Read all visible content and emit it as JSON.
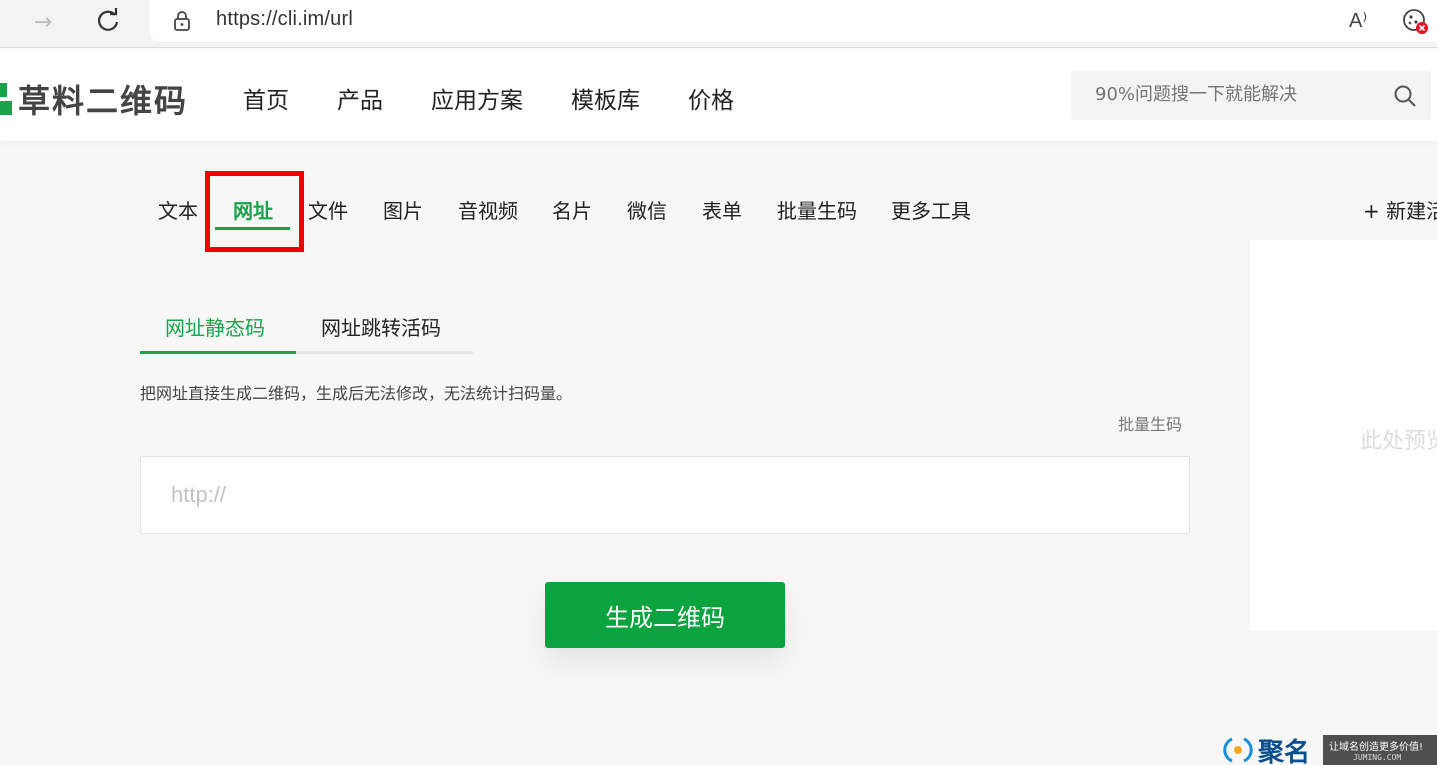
{
  "browser": {
    "url": "https://cli.im/url",
    "read_aloud_glyph": "A⁾"
  },
  "site": {
    "logo_text": "草料二维码",
    "brand_color": "#19a34b",
    "nav": [
      "首页",
      "产品",
      "应用方案",
      "模板库",
      "价格"
    ],
    "search_placeholder": "90%问题搜一下就能解决"
  },
  "tool_tabs": {
    "items": [
      "文本",
      "网址",
      "文件",
      "图片",
      "音视频",
      "名片",
      "微信",
      "表单",
      "批量生码",
      "更多工具"
    ],
    "active": "网址",
    "new_label": "+ 新建活"
  },
  "sub_tabs": {
    "active_label": "网址静态码",
    "other_label": "网址跳转活码"
  },
  "form": {
    "description": "把网址直接生成二维码，生成后无法修改，无法统计扫码量。",
    "batch_link": "批量生码",
    "url_placeholder": "http://",
    "generate_label": "生成二维码"
  },
  "preview": {
    "text": "此处预览"
  },
  "watermark": {
    "logo_text": "聚名",
    "slogan": "让域名创造更多价值!",
    "domain": "JUMING.COM"
  }
}
